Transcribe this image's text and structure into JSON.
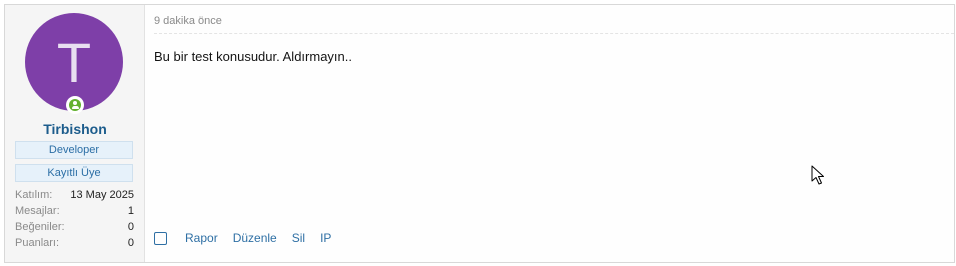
{
  "user": {
    "avatar_letter": "T",
    "username": "Tirbishon",
    "badges": [
      "Developer",
      "Kayıtlı Üye"
    ],
    "stats": [
      {
        "label": "Katılım:",
        "value": "13 May 2025"
      },
      {
        "label": "Mesajlar:",
        "value": "1"
      },
      {
        "label": "Beğeniler:",
        "value": "0"
      },
      {
        "label": "Puanları:",
        "value": "0"
      }
    ]
  },
  "post": {
    "timestamp": "9 dakika önce",
    "body": "Bu bir test konusudur. Aldırmayın..",
    "actions": {
      "report": "Rapor",
      "edit": "Düzenle",
      "delete": "Sil",
      "ip": "IP"
    }
  },
  "icons": {
    "online": "online-status-icon",
    "cursor": "mouse-pointer-icon"
  },
  "colors": {
    "avatar_bg": "#7e3fa8",
    "username": "#1c5c8c",
    "link": "#2e6fa4",
    "online": "#63b12f"
  }
}
